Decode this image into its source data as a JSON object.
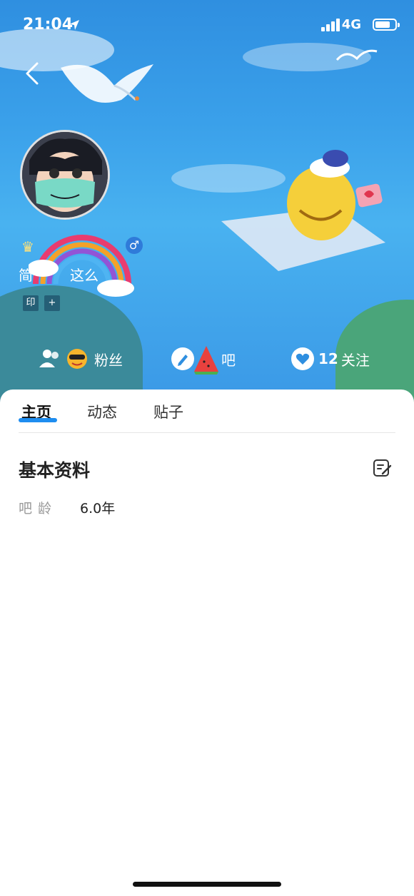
{
  "status_bar": {
    "time": "21:04",
    "network": "4G"
  },
  "profile": {
    "username_parts": [
      "简",
      "这么"
    ],
    "tags": [
      "印",
      "+"
    ]
  },
  "stats": {
    "fans": {
      "count": "",
      "label": "粉丝"
    },
    "bars": {
      "count": "",
      "label": "吧"
    },
    "following": {
      "count": "12",
      "label": "关注"
    }
  },
  "tabs": [
    {
      "label": "主页"
    },
    {
      "label": "动态"
    },
    {
      "label": "贴子"
    }
  ],
  "basic_info": {
    "title": "基本资料",
    "rows": [
      {
        "label": "吧龄",
        "value": "6.0年"
      }
    ]
  },
  "colors": {
    "accent": "#1e8df0",
    "hero_blue": "#3aa0ea",
    "gender_badge": "#2f7bd9"
  },
  "icons": [
    "location-arrow-icon",
    "signal-icon",
    "battery-icon",
    "back-chevron-icon",
    "male-icon",
    "fans-icon",
    "pencil-icon",
    "heart-icon",
    "edit-icon"
  ]
}
